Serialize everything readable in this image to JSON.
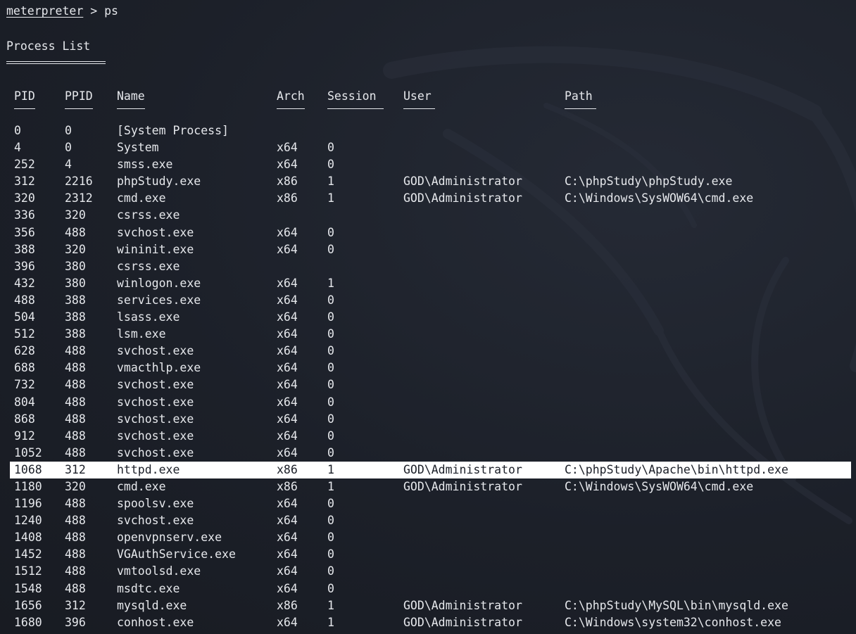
{
  "prompt": {
    "name": "meterpreter",
    "separator": " > ",
    "command": "ps"
  },
  "title": "Process List",
  "columns": {
    "pid": "PID",
    "ppid": "PPID",
    "name": "Name",
    "arch": "Arch",
    "session": "Session",
    "user": "User",
    "path": "Path"
  },
  "selected_row_index": 20,
  "rows": [
    {
      "pid": "0",
      "ppid": "0",
      "name": "[System Process]",
      "arch": "",
      "session": "",
      "user": "",
      "path": ""
    },
    {
      "pid": "4",
      "ppid": "0",
      "name": "System",
      "arch": "x64",
      "session": "0",
      "user": "",
      "path": ""
    },
    {
      "pid": "252",
      "ppid": "4",
      "name": "smss.exe",
      "arch": "x64",
      "session": "0",
      "user": "",
      "path": ""
    },
    {
      "pid": "312",
      "ppid": "2216",
      "name": "phpStudy.exe",
      "arch": "x86",
      "session": "1",
      "user": "GOD\\Administrator",
      "path": "C:\\phpStudy\\phpStudy.exe"
    },
    {
      "pid": "320",
      "ppid": "2312",
      "name": "cmd.exe",
      "arch": "x86",
      "session": "1",
      "user": "GOD\\Administrator",
      "path": "C:\\Windows\\SysWOW64\\cmd.exe"
    },
    {
      "pid": "336",
      "ppid": "320",
      "name": "csrss.exe",
      "arch": "",
      "session": "",
      "user": "",
      "path": ""
    },
    {
      "pid": "356",
      "ppid": "488",
      "name": "svchost.exe",
      "arch": "x64",
      "session": "0",
      "user": "",
      "path": ""
    },
    {
      "pid": "388",
      "ppid": "320",
      "name": "wininit.exe",
      "arch": "x64",
      "session": "0",
      "user": "",
      "path": ""
    },
    {
      "pid": "396",
      "ppid": "380",
      "name": "csrss.exe",
      "arch": "",
      "session": "",
      "user": "",
      "path": ""
    },
    {
      "pid": "432",
      "ppid": "380",
      "name": "winlogon.exe",
      "arch": "x64",
      "session": "1",
      "user": "",
      "path": ""
    },
    {
      "pid": "488",
      "ppid": "388",
      "name": "services.exe",
      "arch": "x64",
      "session": "0",
      "user": "",
      "path": ""
    },
    {
      "pid": "504",
      "ppid": "388",
      "name": "lsass.exe",
      "arch": "x64",
      "session": "0",
      "user": "",
      "path": ""
    },
    {
      "pid": "512",
      "ppid": "388",
      "name": "lsm.exe",
      "arch": "x64",
      "session": "0",
      "user": "",
      "path": ""
    },
    {
      "pid": "628",
      "ppid": "488",
      "name": "svchost.exe",
      "arch": "x64",
      "session": "0",
      "user": "",
      "path": ""
    },
    {
      "pid": "688",
      "ppid": "488",
      "name": "vmacthlp.exe",
      "arch": "x64",
      "session": "0",
      "user": "",
      "path": ""
    },
    {
      "pid": "732",
      "ppid": "488",
      "name": "svchost.exe",
      "arch": "x64",
      "session": "0",
      "user": "",
      "path": ""
    },
    {
      "pid": "804",
      "ppid": "488",
      "name": "svchost.exe",
      "arch": "x64",
      "session": "0",
      "user": "",
      "path": ""
    },
    {
      "pid": "868",
      "ppid": "488",
      "name": "svchost.exe",
      "arch": "x64",
      "session": "0",
      "user": "",
      "path": ""
    },
    {
      "pid": "912",
      "ppid": "488",
      "name": "svchost.exe",
      "arch": "x64",
      "session": "0",
      "user": "",
      "path": ""
    },
    {
      "pid": "1052",
      "ppid": "488",
      "name": "svchost.exe",
      "arch": "x64",
      "session": "0",
      "user": "",
      "path": ""
    },
    {
      "pid": "1068",
      "ppid": "312",
      "name": "httpd.exe",
      "arch": "x86",
      "session": "1",
      "user": "GOD\\Administrator",
      "path": "C:\\phpStudy\\Apache\\bin\\httpd.exe"
    },
    {
      "pid": "1180",
      "ppid": "320",
      "name": "cmd.exe",
      "arch": "x86",
      "session": "1",
      "user": "GOD\\Administrator",
      "path": "C:\\Windows\\SysWOW64\\cmd.exe"
    },
    {
      "pid": "1196",
      "ppid": "488",
      "name": "spoolsv.exe",
      "arch": "x64",
      "session": "0",
      "user": "",
      "path": ""
    },
    {
      "pid": "1240",
      "ppid": "488",
      "name": "svchost.exe",
      "arch": "x64",
      "session": "0",
      "user": "",
      "path": ""
    },
    {
      "pid": "1408",
      "ppid": "488",
      "name": "openvpnserv.exe",
      "arch": "x64",
      "session": "0",
      "user": "",
      "path": ""
    },
    {
      "pid": "1452",
      "ppid": "488",
      "name": "VGAuthService.exe",
      "arch": "x64",
      "session": "0",
      "user": "",
      "path": ""
    },
    {
      "pid": "1512",
      "ppid": "488",
      "name": "vmtoolsd.exe",
      "arch": "x64",
      "session": "0",
      "user": "",
      "path": ""
    },
    {
      "pid": "1548",
      "ppid": "488",
      "name": "msdtc.exe",
      "arch": "x64",
      "session": "0",
      "user": "",
      "path": ""
    },
    {
      "pid": "1656",
      "ppid": "312",
      "name": "mysqld.exe",
      "arch": "x86",
      "session": "1",
      "user": "GOD\\Administrator",
      "path": "C:\\phpStudy\\MySQL\\bin\\mysqld.exe"
    },
    {
      "pid": "1680",
      "ppid": "396",
      "name": "conhost.exe",
      "arch": "x64",
      "session": "1",
      "user": "GOD\\Administrator",
      "path": "C:\\Windows\\system32\\conhost.exe"
    }
  ],
  "icons": {
    "background_watermark": "kali-dragon-icon"
  },
  "colors": {
    "background": "#1b1f28",
    "text": "#e6e8ec",
    "selection": "#ffffff"
  }
}
